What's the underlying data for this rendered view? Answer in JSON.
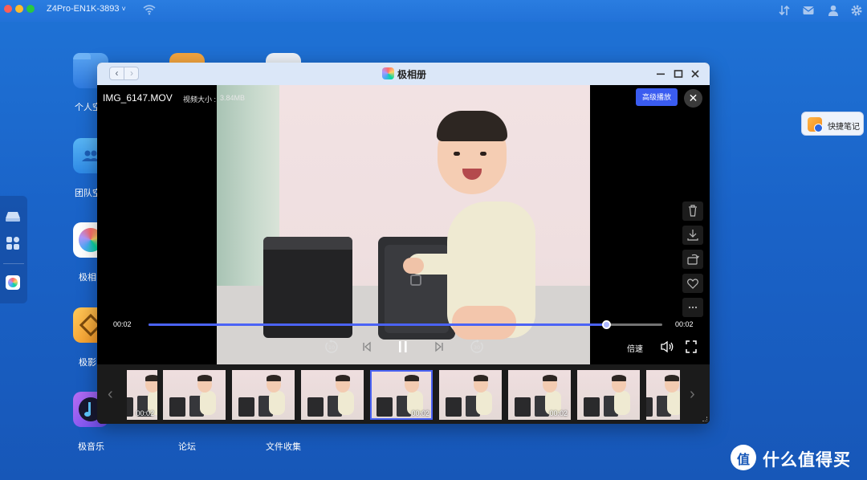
{
  "topbar": {
    "device_name": "Z4Pro-EN1K-3893",
    "caret": "˅",
    "right_icons": [
      "transfer-icon",
      "message-icon",
      "user-icon",
      "settings-icon"
    ]
  },
  "desktop": {
    "apps": [
      {
        "label": "个人空",
        "name": "personal-space"
      },
      {
        "label": "团队空",
        "name": "team-space"
      },
      {
        "label": "极相",
        "name": "photos"
      },
      {
        "label": "极影",
        "name": "video"
      },
      {
        "label": "极音乐",
        "name": "music"
      },
      {
        "label": "论坛",
        "name": "forum"
      },
      {
        "label": "文件收集",
        "name": "file-collect"
      }
    ]
  },
  "quick_note": {
    "label": "快捷笔记"
  },
  "watermark": {
    "text": "什么值得买",
    "logo_text": "值"
  },
  "window": {
    "title": "极相册",
    "back": "‹",
    "forward": "›"
  },
  "viewer": {
    "filename": "IMG_6147.MOV",
    "filesize_label": "视频大小 :",
    "filesize_value": "3.84MB",
    "advanced_play": "高级播放",
    "close": "✕",
    "time_current": "00:02",
    "time_total": "00:02",
    "progress": 0.89,
    "speed_label": "倍速",
    "side_tools": [
      "trash-icon",
      "download-icon",
      "rotate-icon",
      "heart-icon",
      "more-icon"
    ]
  },
  "thumbnails": [
    {
      "time": "00:02",
      "active": false
    },
    {
      "time": "",
      "active": false
    },
    {
      "time": "",
      "active": false
    },
    {
      "time": "",
      "active": false
    },
    {
      "time": "00:02",
      "active": true
    },
    {
      "time": "",
      "active": false
    },
    {
      "time": "00:02",
      "active": false
    },
    {
      "time": "",
      "active": false
    },
    {
      "time": "",
      "active": false
    }
  ],
  "colors": {
    "accent": "#3a5cf0",
    "desktop_bg": "#1a63c8",
    "titlebar": "#dbe7f8"
  }
}
